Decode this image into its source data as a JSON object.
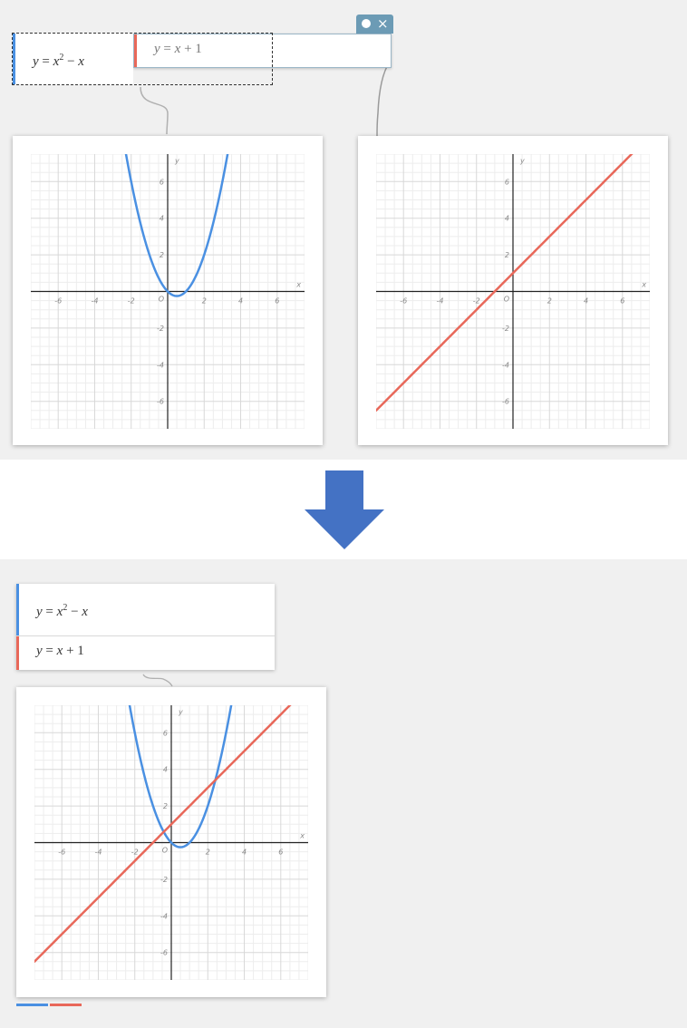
{
  "colors": {
    "blue": "#4a90e2",
    "red": "#e8685a",
    "arrow": "#4472c4",
    "grid_minor": "#ededed",
    "grid_major": "#d8d8d8",
    "axis": "#222222",
    "tick_label": "#888888"
  },
  "top": {
    "expr1": {
      "lhs": "y",
      "eq": "=",
      "base": "x",
      "exp": "2",
      "op": "−",
      "rhs": "x"
    },
    "expr2": {
      "lhs": "y",
      "eq": "=",
      "var": "x",
      "op": "+",
      "const": "1"
    },
    "toolbar": {
      "icon_dot": "circle-icon",
      "close": "×"
    }
  },
  "bottom": {
    "expr1": {
      "lhs": "y",
      "eq": "=",
      "base": "x",
      "exp": "2",
      "op": "−",
      "rhs": "x"
    },
    "expr2": {
      "lhs": "y",
      "eq": "=",
      "var": "x",
      "op": "+",
      "const": "1"
    }
  },
  "chart_data": [
    {
      "type": "line",
      "xlim": [
        -7.5,
        7.5
      ],
      "ylim": [
        -7.5,
        7.5
      ],
      "xlabel": "x",
      "ylabel": "y",
      "ticks": [
        -6,
        -4,
        -2,
        2,
        4,
        6
      ],
      "origin_label": "O",
      "grid": true,
      "series": [
        {
          "expression": "y=x^2-x",
          "color": "#4a90e2"
        }
      ]
    },
    {
      "type": "line",
      "xlim": [
        -7.5,
        7.5
      ],
      "ylim": [
        -7.5,
        7.5
      ],
      "xlabel": "x",
      "ylabel": "y",
      "ticks": [
        -6,
        -4,
        -2,
        2,
        4,
        6
      ],
      "origin_label": "O",
      "grid": true,
      "series": [
        {
          "expression": "y=x+1",
          "color": "#e8685a"
        }
      ]
    },
    {
      "type": "line",
      "xlim": [
        -7.5,
        7.5
      ],
      "ylim": [
        -7.5,
        7.5
      ],
      "xlabel": "x",
      "ylabel": "y",
      "ticks": [
        -6,
        -4,
        -2,
        2,
        4,
        6
      ],
      "origin_label": "O",
      "grid": true,
      "series": [
        {
          "expression": "y=x^2-x",
          "color": "#4a90e2"
        },
        {
          "expression": "y=x+1",
          "color": "#e8685a"
        }
      ]
    }
  ]
}
